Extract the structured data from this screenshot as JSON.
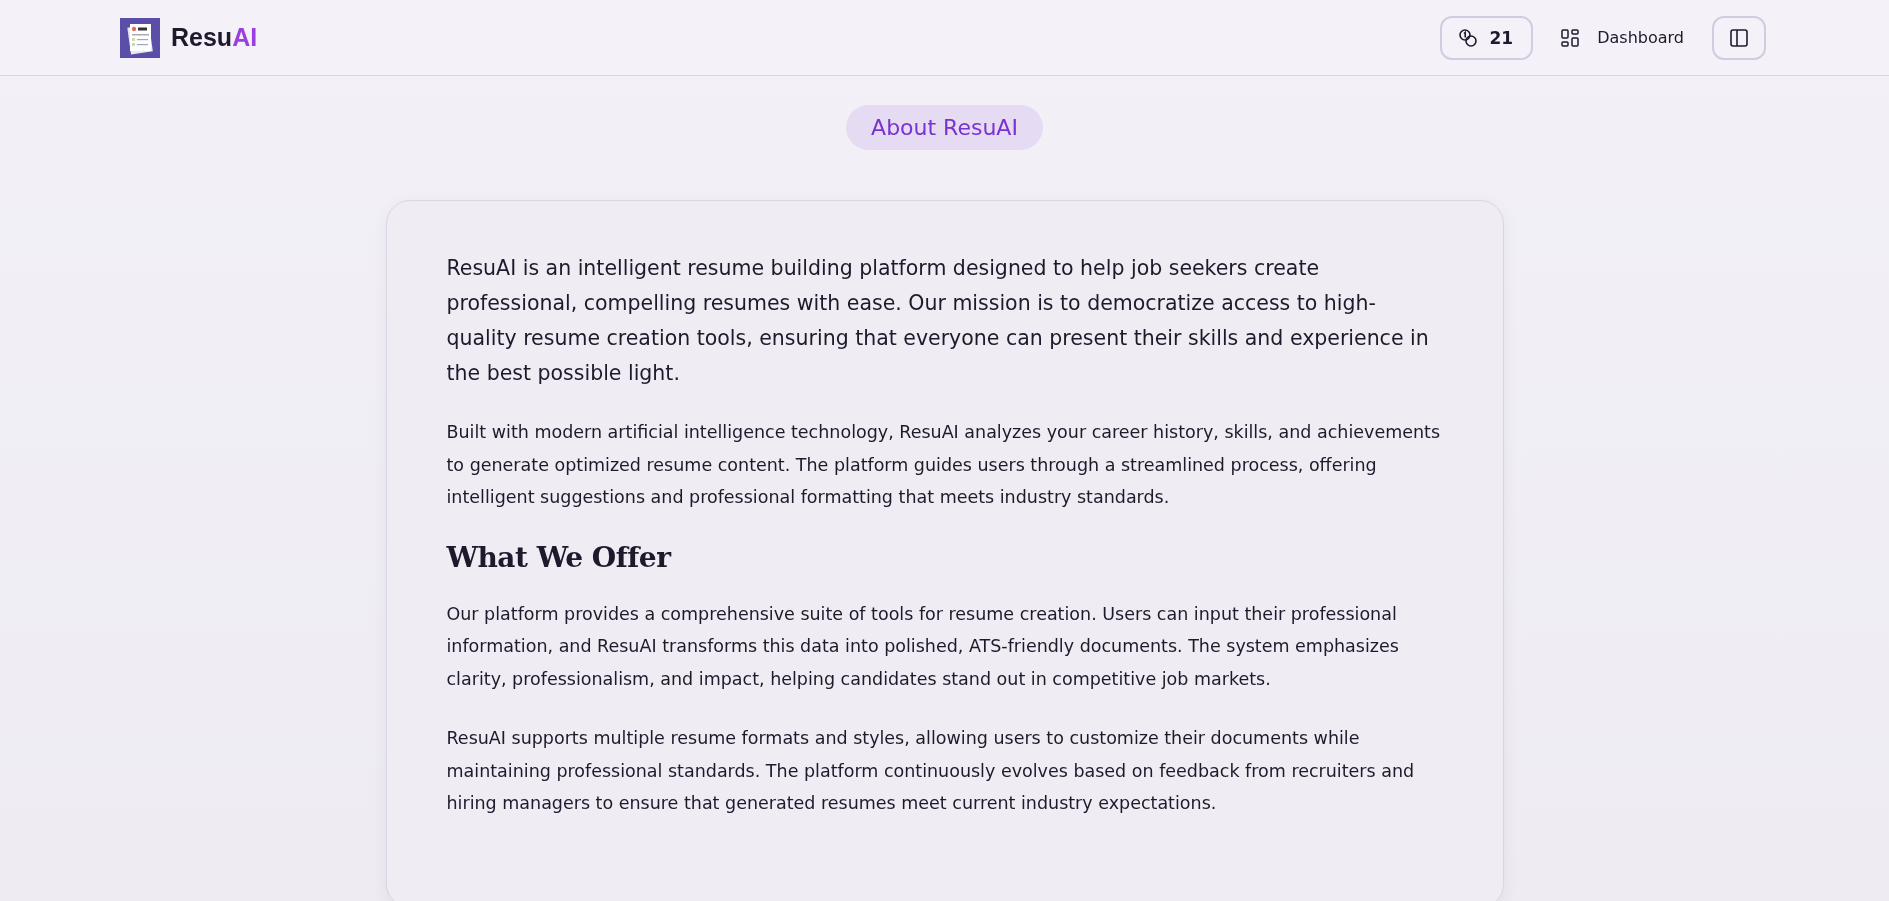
{
  "header": {
    "brand": {
      "main": "Resu",
      "accent": "AI"
    },
    "credits": "21",
    "dashboard_link": "Dashboard"
  },
  "page_badge": "About ResuAI",
  "content": [
    {
      "kind": "lead",
      "text": "ResuAI is an intelligent resume building platform designed to help job seekers create professional, compelling resumes with ease. Our mission is to democratize access to high-quality resume creation tools, ensuring that everyone can present their skills and experience in the best possible light."
    },
    {
      "kind": "paragraph",
      "text": "Built with modern artificial intelligence technology, ResuAI analyzes your career history, skills, and achievements to generate optimized resume content. The platform guides users through a streamlined process, offering intelligent suggestions and professional formatting that meets industry standards."
    },
    {
      "kind": "heading",
      "text": "What We Offer"
    },
    {
      "kind": "paragraph",
      "text": "Our platform provides a comprehensive suite of tools for resume creation. Users can input their professional information, and ResuAI transforms this data into polished, ATS-friendly documents. The system emphasizes clarity, professionalism, and impact, helping candidates stand out in competitive job markets."
    },
    {
      "kind": "paragraph",
      "text": "ResuAI supports multiple resume formats and styles, allowing users to customize their documents while maintaining professional standards. The platform continuously evolves based on feedback from recruiters and hiring managers to ensure that generated resumes meet current industry expectations."
    }
  ]
}
